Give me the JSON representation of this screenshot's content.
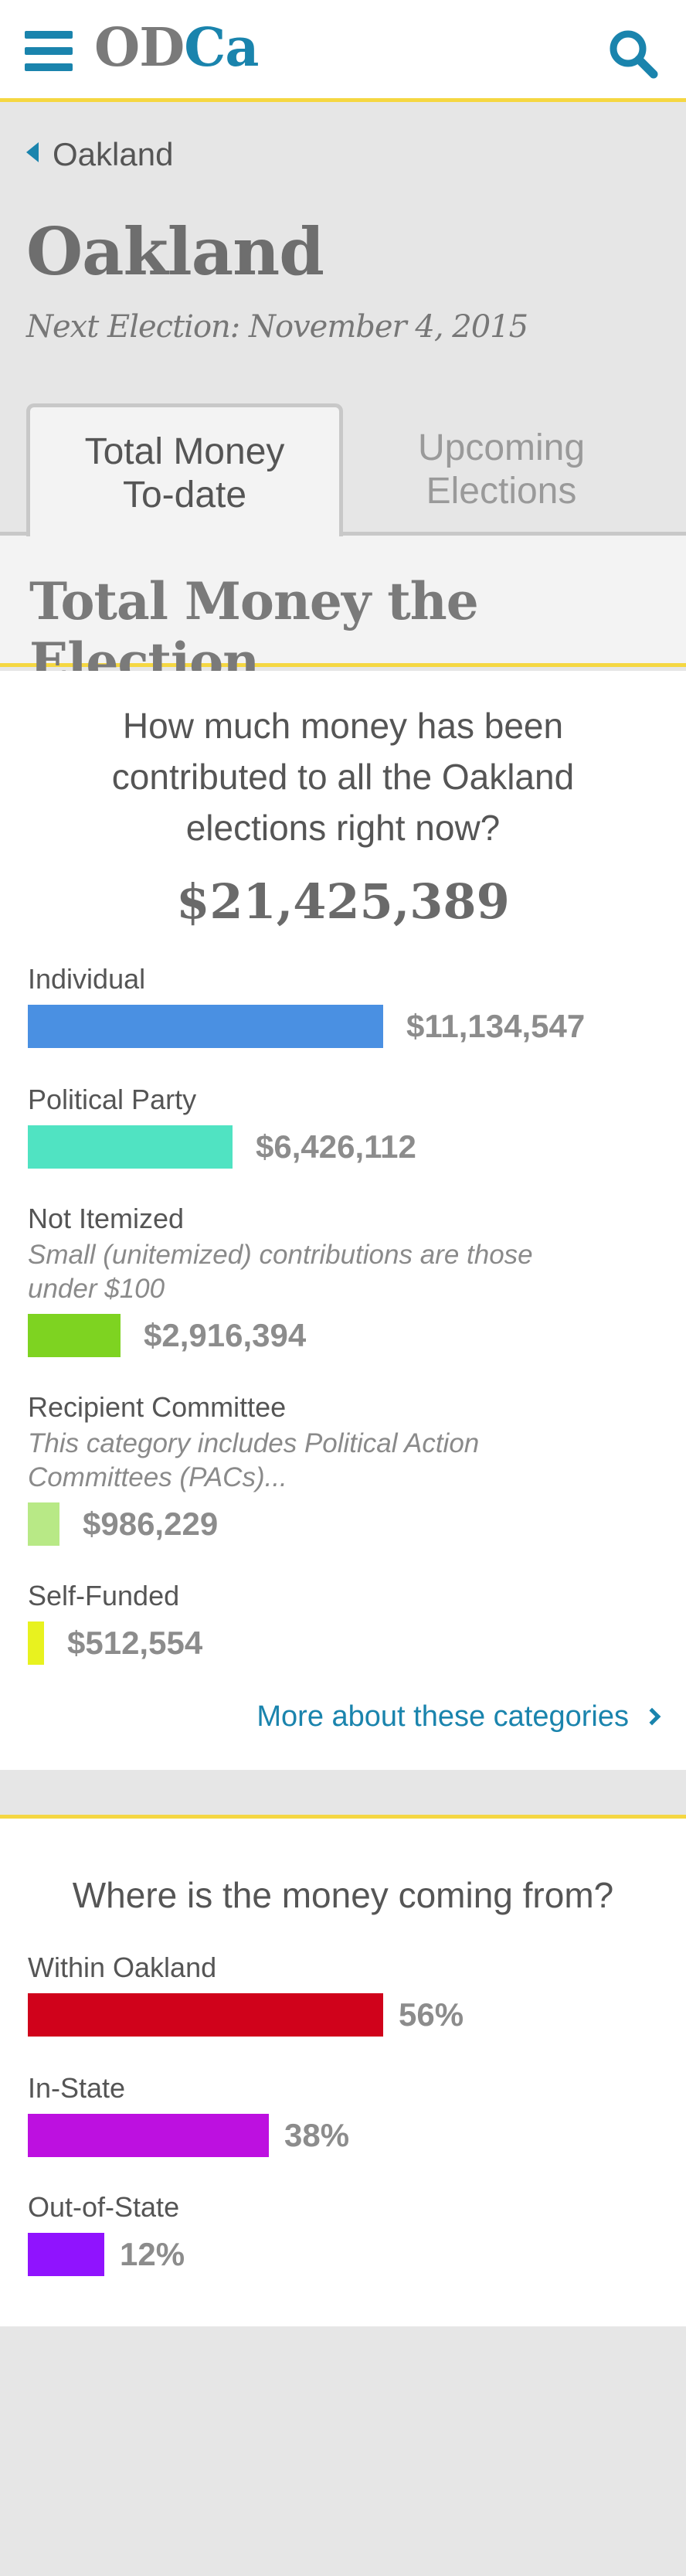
{
  "header": {
    "logo_od": "OD",
    "logo_ca": "Ca",
    "accent_color": "#1a84ad",
    "rule_color": "#f5d742",
    "menu_icon": "hamburger-menu-icon",
    "search_icon": "search-icon"
  },
  "breadcrumb": {
    "label": "Oakland",
    "icon": "caret-left-icon"
  },
  "page": {
    "title": "Oakland",
    "next_election": "Next Election: November 4, 2015"
  },
  "tabs": [
    {
      "line1": "Total Money",
      "line2": "To-date",
      "active": true
    },
    {
      "line1": "Upcoming",
      "line2": "Elections",
      "active": false
    }
  ],
  "section": {
    "title": "Total Money the Election"
  },
  "contributions": {
    "question_lines": [
      "How much money has been",
      "contributed to all the Oakland",
      "elections right now?"
    ],
    "total": "$21,425,389",
    "categories": [
      {
        "label": "Individual",
        "desc": [],
        "value": "$11,134,547",
        "amount": 11134547,
        "color": "#4a90e2"
      },
      {
        "label": "Political Party",
        "desc": [],
        "value": "$6,426,112",
        "amount": 6426112,
        "color": "#50e3c2"
      },
      {
        "label": "Not Itemized",
        "desc": [
          "Small (unitemized) contributions are those",
          "under $100"
        ],
        "value": "$2,916,394",
        "amount": 2916394,
        "color": "#7ed321"
      },
      {
        "label": "Recipient Committee",
        "desc": [
          "This category includes Political Action",
          "Committees (PACs)..."
        ],
        "value": "$986,229",
        "amount": 986229,
        "color": "#b8e986"
      },
      {
        "label": "Self-Funded",
        "desc": [],
        "value": "$512,554",
        "amount": 512554,
        "color": "#e8f21f"
      }
    ],
    "more_link": "More about these categories",
    "more_icon": "chevron-right-icon"
  },
  "origin": {
    "question": "Where is the money coming from?",
    "categories": [
      {
        "label": "Within Oakland",
        "value": "56%",
        "percent": 56,
        "color": "#d0021b"
      },
      {
        "label": "In-State",
        "value": "38%",
        "percent": 38,
        "color": "#bd10e0"
      },
      {
        "label": "Out-of-State",
        "value": "12%",
        "percent": 12,
        "color": "#9013fe"
      }
    ]
  }
}
